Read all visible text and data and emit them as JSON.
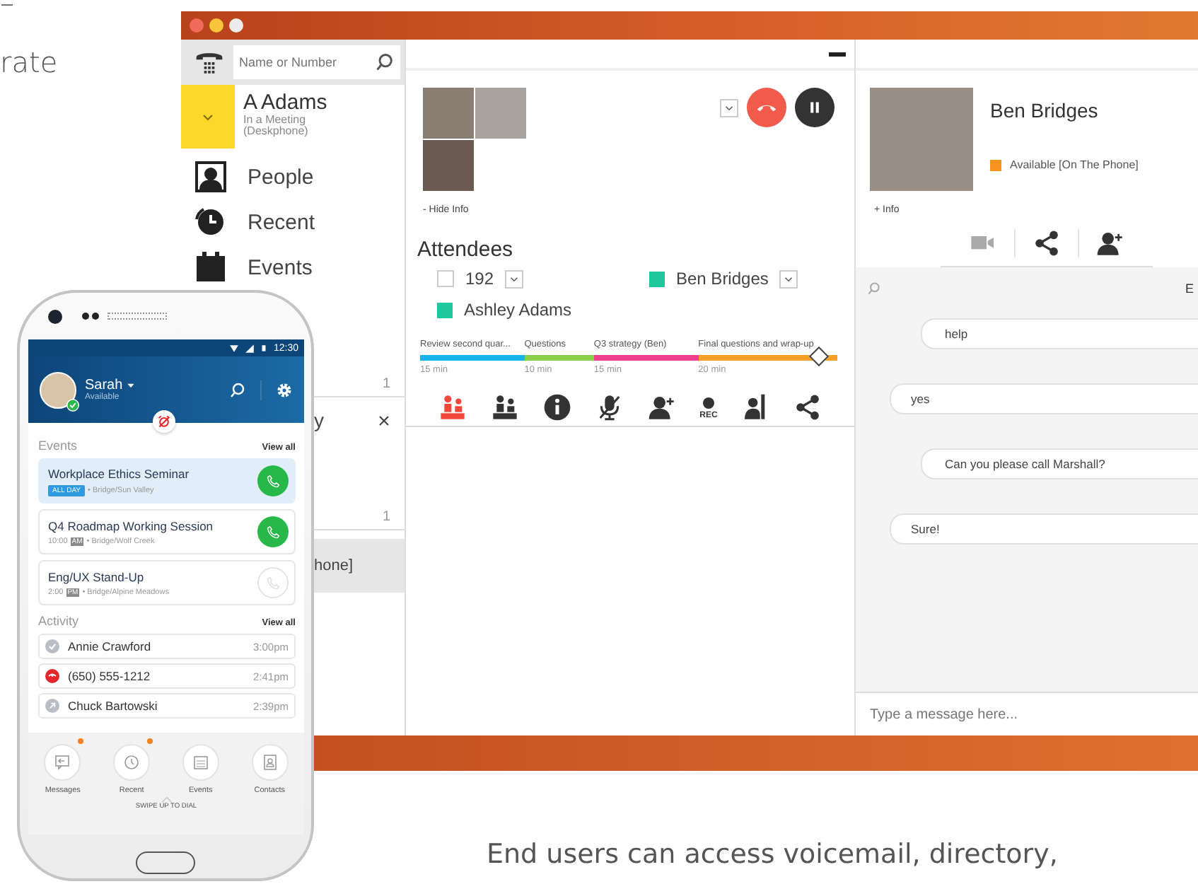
{
  "page": {
    "heading_lines": [
      "–",
      "rate"
    ],
    "caption": "End users can access voicemail, directory,"
  },
  "desktop": {
    "search": {
      "placeholder": "Name or Number"
    },
    "current_user": {
      "name": "A Adams",
      "status": "In a Meeting (Deskphone)"
    },
    "nav": [
      {
        "label": "People",
        "kind": "people"
      },
      {
        "label": "Recent",
        "kind": "recent"
      },
      {
        "label": "Events",
        "kind": "events"
      }
    ],
    "conversations": [
      {
        "kind": "count",
        "text": "1"
      },
      {
        "kind": "item",
        "text": "y",
        "closable": true,
        "selected": false
      },
      {
        "kind": "count",
        "text": "1"
      },
      {
        "kind": "item",
        "text": "hone]",
        "closable": false,
        "selected": true
      }
    ],
    "call": {
      "hide_info": "- Hide Info",
      "attendees_title": "Attendees",
      "attendees": [
        {
          "name": "192",
          "kind": "checkbox",
          "checked": false,
          "menu": true
        },
        {
          "name": "Ben Bridges",
          "kind": "present",
          "menu": true
        },
        {
          "name": "Ashley Adams",
          "kind": "present",
          "menu": false
        }
      ],
      "agenda": [
        {
          "label": "Review second quar...",
          "duration": "15 min",
          "color": "#1ab2ea"
        },
        {
          "label": "Questions",
          "duration": "10 min",
          "color": "#8ccf4a"
        },
        {
          "label": "Q3 strategy (Ben)",
          "duration": "15 min",
          "color": "#ec3f8c"
        },
        {
          "label": "Final questions and wrap-up",
          "duration": "20 min",
          "color": "#f7a12a"
        }
      ],
      "agenda_progress": {
        "level": 0.955
      },
      "tools": [
        {
          "kind": "meeting",
          "active": true
        },
        {
          "kind": "meeting",
          "active": false
        },
        {
          "kind": "info",
          "active": false
        },
        {
          "kind": "mute",
          "active": false
        },
        {
          "kind": "add-person",
          "active": false
        },
        {
          "kind": "record",
          "active": false,
          "label": "REC"
        },
        {
          "kind": "park",
          "active": false
        },
        {
          "kind": "share",
          "active": false
        }
      ]
    },
    "contact": {
      "name": "Ben Bridges",
      "status": {
        "text": "Available [On The Phone]",
        "color": "#f7941d"
      },
      "info": "+ Info",
      "actions": [
        {
          "kind": "video",
          "disabled": true
        },
        {
          "kind": "share",
          "disabled": false
        },
        {
          "kind": "add-person",
          "disabled": false
        }
      ]
    },
    "chat": {
      "header_fragment": "E",
      "messages": [
        {
          "text": "help",
          "kind": "sent"
        },
        {
          "text": "yes",
          "kind": "received"
        },
        {
          "text": "Can you please call Marshall?",
          "kind": "sent"
        },
        {
          "text": "Sure!",
          "kind": "received"
        }
      ],
      "input_placeholder": "Type a message here..."
    }
  },
  "phone": {
    "status_time": "12:30",
    "user": {
      "name": "Sarah",
      "status": "Available"
    },
    "events_title": "Events",
    "events_view_all": "View all",
    "events": [
      {
        "title": "Workplace Ethics Seminar",
        "kind": "all_day",
        "time": "ALL DAY",
        "location": "• Bridge/Sun Valley",
        "selected": true,
        "joinable": true
      },
      {
        "title": "Q4 Roadmap Working Session",
        "kind": "timed",
        "time": "10:00",
        "meridiem": "AM",
        "location": "• Bridge/Wolf Creek",
        "selected": false,
        "joinable": true
      },
      {
        "title": "Eng/UX Stand-Up",
        "kind": "timed",
        "time": "2:00",
        "meridiem": "PM",
        "location": "• Bridge/Alpine Meadows",
        "selected": false,
        "joinable": false
      }
    ],
    "activity_title": "Activity",
    "activity_view_all": "View all",
    "activity": [
      {
        "name": "Annie Crawford",
        "time": "3:00pm",
        "kind": "answered"
      },
      {
        "name": "(650) 555-1212",
        "time": "2:41pm",
        "kind": "missed"
      },
      {
        "name": "Chuck Bartowski",
        "time": "2:39pm",
        "kind": "outgoing"
      }
    ],
    "tabs": [
      {
        "label": "Messages",
        "kind": "messages",
        "unread": true
      },
      {
        "label": "Recent",
        "kind": "recent",
        "unread": true
      },
      {
        "label": "Events",
        "kind": "events",
        "unread": false
      },
      {
        "label": "Contacts",
        "kind": "contacts",
        "unread": false
      }
    ],
    "swipe_hint": "SWIPE UP TO DIAL"
  }
}
